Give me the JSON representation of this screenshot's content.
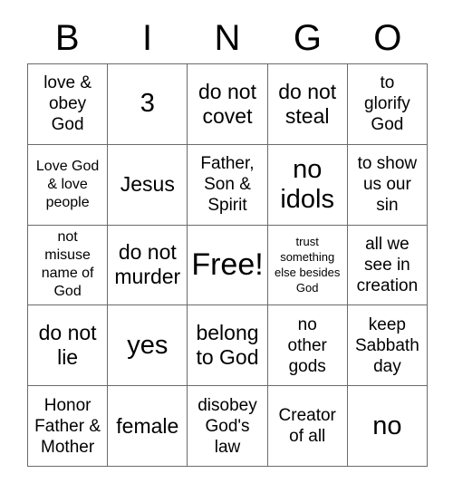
{
  "card": {
    "title": "BINGO",
    "header_letters": [
      "B",
      "I",
      "N",
      "G",
      "O"
    ],
    "free_space_label": "Free!",
    "grid": {
      "rows": 5,
      "columns": 5,
      "border_color": "#6b6b6b",
      "background_color": "#ffffff",
      "text_color": "#000000"
    },
    "cells": [
      {
        "text": "love &\nobey\nGod",
        "size": "md",
        "column": "B",
        "row": 1
      },
      {
        "text": "3",
        "size": "xl",
        "column": "I",
        "row": 1
      },
      {
        "text": "do not\ncovet",
        "size": "lg",
        "column": "N",
        "row": 1
      },
      {
        "text": "do not\nsteal",
        "size": "lg",
        "column": "G",
        "row": 1
      },
      {
        "text": "to\nglorify\nGod",
        "size": "md",
        "column": "O",
        "row": 1
      },
      {
        "text": "Love God\n& love\npeople",
        "size": "sm",
        "column": "B",
        "row": 2
      },
      {
        "text": "Jesus",
        "size": "lg",
        "column": "I",
        "row": 2
      },
      {
        "text": "Father,\nSon &\nSpirit",
        "size": "md",
        "column": "N",
        "row": 2
      },
      {
        "text": "no\nidols",
        "size": "xl",
        "column": "G",
        "row": 2
      },
      {
        "text": "to show\nus our\nsin",
        "size": "md",
        "column": "O",
        "row": 2
      },
      {
        "text": "not\nmisuse\nname of\nGod",
        "size": "sm",
        "column": "B",
        "row": 3
      },
      {
        "text": "do not\nmurder",
        "size": "lg",
        "column": "I",
        "row": 3
      },
      {
        "text": "Free!",
        "size": "xxl",
        "column": "N",
        "row": 3
      },
      {
        "text": "trust\nsomething\nelse besides\nGod",
        "size": "xs",
        "column": "G",
        "row": 3
      },
      {
        "text": "all we\nsee in\ncreation",
        "size": "md",
        "column": "O",
        "row": 3
      },
      {
        "text": "do not\nlie",
        "size": "lg",
        "column": "B",
        "row": 4
      },
      {
        "text": "yes",
        "size": "xl",
        "column": "I",
        "row": 4
      },
      {
        "text": "belong\nto God",
        "size": "lg",
        "column": "N",
        "row": 4
      },
      {
        "text": "no\nother\ngods",
        "size": "md",
        "column": "G",
        "row": 4
      },
      {
        "text": "keep\nSabbath\nday",
        "size": "md",
        "column": "O",
        "row": 4
      },
      {
        "text": "Honor\nFather &\nMother",
        "size": "md",
        "column": "B",
        "row": 5
      },
      {
        "text": "female",
        "size": "lg",
        "column": "I",
        "row": 5
      },
      {
        "text": "disobey\nGod's\nlaw",
        "size": "md",
        "column": "N",
        "row": 5
      },
      {
        "text": "Creator\nof all",
        "size": "md",
        "column": "G",
        "row": 5
      },
      {
        "text": "no",
        "size": "xl",
        "column": "O",
        "row": 5
      }
    ]
  }
}
